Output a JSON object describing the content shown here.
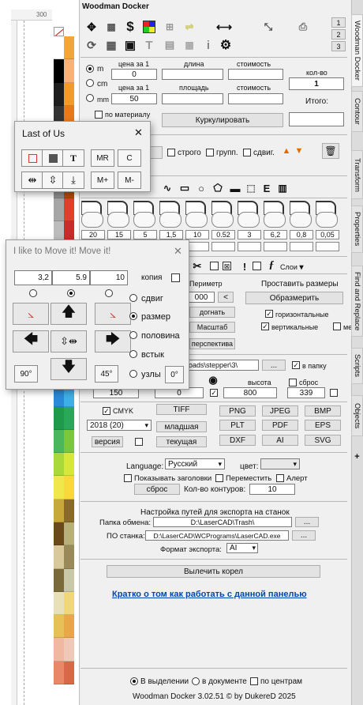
{
  "panel": {
    "title": "Woodman Docker",
    "page_buttons": [
      "1",
      "2",
      "3"
    ],
    "toolbar_icons": [
      "move-icon",
      "color-grid-icon",
      "dollar-icon",
      "color-squares-icon",
      "align-icon",
      "width-icon",
      "resize-icon",
      "print-icon",
      "rotate-icon",
      "grid-icon",
      "save-icon",
      "text-icon",
      "image-icon",
      "info-icon",
      "gear-icon"
    ]
  },
  "units": {
    "options": [
      "m",
      "cm",
      "mm"
    ],
    "selected": "m"
  },
  "pricing": {
    "price_label1": "цена за 1",
    "length_label": "длина",
    "cost_label1": "стоимость",
    "price_value1": "0",
    "price_label2": "цена за 1",
    "area_label": "площадь",
    "cost_label2": "стоимость",
    "price_value2": "50",
    "qty_label": "кол-во",
    "qty_value": "1",
    "total_label": "Итого:",
    "by_material_label": "по материалу",
    "kurkul_button": "Куркулировать"
  },
  "strict_row": {
    "strict_label": "строго",
    "group_label": "групп.",
    "shift_label": "сдвиг."
  },
  "shapes": {
    "values": [
      "20",
      "15",
      "5",
      "1,5",
      "10",
      "0.52",
      "3",
      "6,2",
      "0,8",
      "0,05"
    ]
  },
  "tools_row": {
    "layers_label": "Слои"
  },
  "perimeter": {
    "perimeter_label": "Периметр",
    "perimeter_value": "000",
    "set_dims_label": "Проставить размеры",
    "dimension_button": "Образмерить",
    "fit_button": "догнать",
    "horizontal_label": "горизонтальные",
    "scale_button": "Масштаб",
    "vertical_label": "вертикальные",
    "between_label": "между",
    "perspective_button": "перспектива"
  },
  "export_path": {
    "path_value": "loads\\stepper\\3\\",
    "browse_button": "...",
    "to_folder_label": "в папку",
    "height_label": "высота",
    "reset_label": "сброс",
    "width_value": "150",
    "value2": "0",
    "height_value": "800",
    "value4": "339"
  },
  "formats": {
    "cmyk_label": "CMYK",
    "tiff_button": "TIFF",
    "png_button": "PNG",
    "jpeg_button": "JPEG",
    "bmp_button": "BMP",
    "version_select": "2018 (20)",
    "junior_button": "младшая",
    "plt_button": "PLT",
    "pdf_button": "PDF",
    "eps_button": "EPS",
    "version_button": "версия",
    "current_button": "текущая",
    "dxf_button": "DXF",
    "ai_button": "AI",
    "svg_button": "SVG"
  },
  "settings": {
    "language_label": "Language:",
    "language_value": "Русский",
    "color_label": "цвет:",
    "show_headers_label": "Показывать заголовки",
    "move_label": "Переместить",
    "alert_label": "Алерт",
    "reset_button": "сброс",
    "contours_label": "Кол-во контуров:",
    "contours_value": "10"
  },
  "export_settings": {
    "title": "Настройка путей для экспорта на станок",
    "exchange_folder_label": "Папка обмена:",
    "exchange_folder_value": "D:\\LaserCAD\\Trash\\",
    "machine_label": "ПО станка:",
    "machine_value": "D:\\LaserCAD\\WCPrograms\\LaserCAD.exe",
    "format_label": "Формат экспорта:",
    "format_value": "AI",
    "browse1": "...",
    "browse2": "...",
    "heal_button": "Вылечить корел",
    "help_link": "Кратко о том как работать с данной панелью"
  },
  "footer": {
    "in_selection_label": "В выделении",
    "in_document_label": "в документе",
    "by_centers_label": "по центрам",
    "version_text": "Woodman Docker 3.02.51 © by DukereD 2025"
  },
  "side_tabs": [
    "Woodman Docker",
    "Contour",
    "Transform",
    "Properties",
    "Find and Replace",
    "Scripts",
    "Objects"
  ],
  "ruler": {
    "value": "300"
  },
  "last_of_us": {
    "title": "Last of Us",
    "close": "✕",
    "t_label": "T",
    "mr_label": "MR",
    "c_label": "C",
    "mplus_label": "M+",
    "mminus_label": "M-"
  },
  "move_dialog": {
    "title": "I like to Move it! Move it!",
    "close": "✕",
    "x_value": "3,2",
    "y_value": "5.9",
    "z_value": "10",
    "copy_label": "копия",
    "shift_label": "сдвиг",
    "size_label": "размер",
    "half_label": "половина",
    "flush_label": "встык",
    "nodes_label": "узлы",
    "deg90_label": "90°",
    "deg45_label": "45°",
    "deg0_label": "0°",
    "selected_mode": "размер"
  },
  "palette_colors": [
    "#ffffff",
    "#f3a53a",
    "#000000",
    "#f7b27a",
    "#1e1e1e",
    "#f39a2a",
    "#333333",
    "#e87a1c",
    "#5a5a5a",
    "#e26a12",
    "#7a7a7a",
    "#d45a0c",
    "#8f8f8f",
    "#b84a0a",
    "#a6a6a6",
    "#e23e2e",
    "#bcbcbc",
    "#cc2a2a",
    "#cfcfcf",
    "#a81e1e",
    "#e3e3e3",
    "#7a1414",
    "#ffffff",
    "#e43a6a",
    "#6e2e8e",
    "#8c2a9a",
    "#b4178a",
    "#c43aa8",
    "#3a2e8e",
    "#1e5aa8",
    "#2a8ad8",
    "#3eb0e8",
    "#1e9a4a",
    "#2aa85a",
    "#4ab85a",
    "#7ac83a",
    "#a8d83a",
    "#d8e83a",
    "#f0e84a",
    "#f8d83a",
    "#c8a83a",
    "#8a6a2a",
    "#6a4a1a",
    "#b8b07a",
    "#d8c89a",
    "#9a8a5a",
    "#7a6a3a",
    "#c8c8a8",
    "#e8e0b8",
    "#f0d878",
    "#e8c058",
    "#e8a848",
    "#f0b8a0",
    "#f0c8b8",
    "#e88868",
    "#d86848"
  ]
}
